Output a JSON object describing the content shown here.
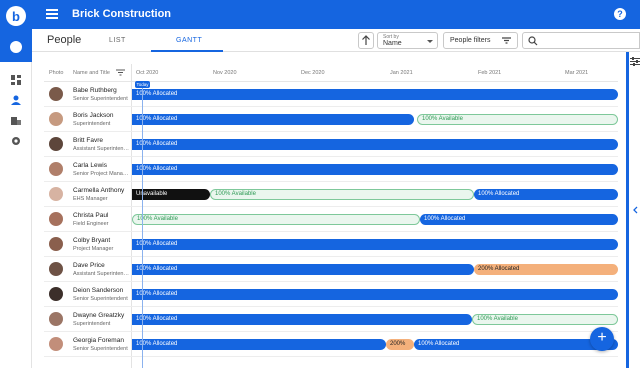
{
  "app": {
    "title": "Brick Construction"
  },
  "page": {
    "title": "People"
  },
  "tabs": [
    {
      "label": "LIST"
    },
    {
      "label": "GANTT"
    }
  ],
  "toolbar": {
    "sort_label": "Sort by",
    "sort_value": "Name",
    "filters_label": "People filters"
  },
  "grid": {
    "headers": {
      "photo": "Photo",
      "name_title": "Name and Title"
    },
    "months": [
      "Oct 2020",
      "Nov 2020",
      "Dec 2020",
      "Jan 2021",
      "Feb 2021",
      "Mar 2021"
    ],
    "today_label": "Today"
  },
  "people": [
    {
      "name": "Babe Ruthberg",
      "title": "Senior Superintendent",
      "segments": [
        {
          "type": "alloc",
          "label": "100% Allocated"
        }
      ]
    },
    {
      "name": "Boris Jackson",
      "title": "Superintendent",
      "segments": [
        {
          "type": "alloc",
          "label": "100% Allocated"
        },
        {
          "type": "avail",
          "label": "100% Available"
        }
      ]
    },
    {
      "name": "Britt Favre",
      "title": "Assistant Superintendent",
      "segments": [
        {
          "type": "alloc",
          "label": "100% Allocated"
        }
      ]
    },
    {
      "name": "Carla Lewis",
      "title": "Senior Project Manager",
      "segments": [
        {
          "type": "alloc",
          "label": "100% Allocated"
        }
      ]
    },
    {
      "name": "Carmella Anthony",
      "title": "EHS Manager",
      "segments": [
        {
          "type": "unavail",
          "label": "Unavailable"
        },
        {
          "type": "avail",
          "label": "100% Available"
        },
        {
          "type": "alloc",
          "label": "100% Allocated"
        }
      ]
    },
    {
      "name": "Christa Paul",
      "title": "Field Engineer",
      "segments": [
        {
          "type": "avail",
          "label": "100% Available"
        },
        {
          "type": "alloc",
          "label": "100% Allocated"
        }
      ]
    },
    {
      "name": "Colby Bryant",
      "title": "Project Manager",
      "segments": [
        {
          "type": "alloc",
          "label": "100% Allocated"
        }
      ]
    },
    {
      "name": "Dave Price",
      "title": "Assistant Superintendent",
      "segments": [
        {
          "type": "alloc",
          "label": "100% Allocated"
        },
        {
          "type": "over",
          "label": "200% Allocated"
        }
      ]
    },
    {
      "name": "Deion Sanderson",
      "title": "Senior Superintendent",
      "segments": [
        {
          "type": "alloc",
          "label": "100% Allocated"
        }
      ]
    },
    {
      "name": "Dwayne Greatzky",
      "title": "Superintendent",
      "segments": [
        {
          "type": "alloc",
          "label": "100% Allocated"
        },
        {
          "type": "avail",
          "label": "100% Available"
        }
      ]
    },
    {
      "name": "Georgia Foreman",
      "title": "Senior Superintendent",
      "segments": [
        {
          "type": "alloc",
          "label": "100% Allocated"
        },
        {
          "type": "over",
          "label": "200%"
        },
        {
          "type": "alloc",
          "label": "100% Allocated"
        }
      ]
    }
  ],
  "colors": {
    "brand": "#1565e0",
    "available": "#2e9a55",
    "overallocated": "#f4b07b",
    "unavailable": "#111111"
  },
  "icons": [
    "menu-icon",
    "help-icon",
    "dashboard-icon",
    "person-icon",
    "building-icon",
    "gear-icon",
    "arrow-up-icon",
    "filter-icon",
    "search-icon",
    "add-icon",
    "chevron-left-icon",
    "tune-icon"
  ]
}
